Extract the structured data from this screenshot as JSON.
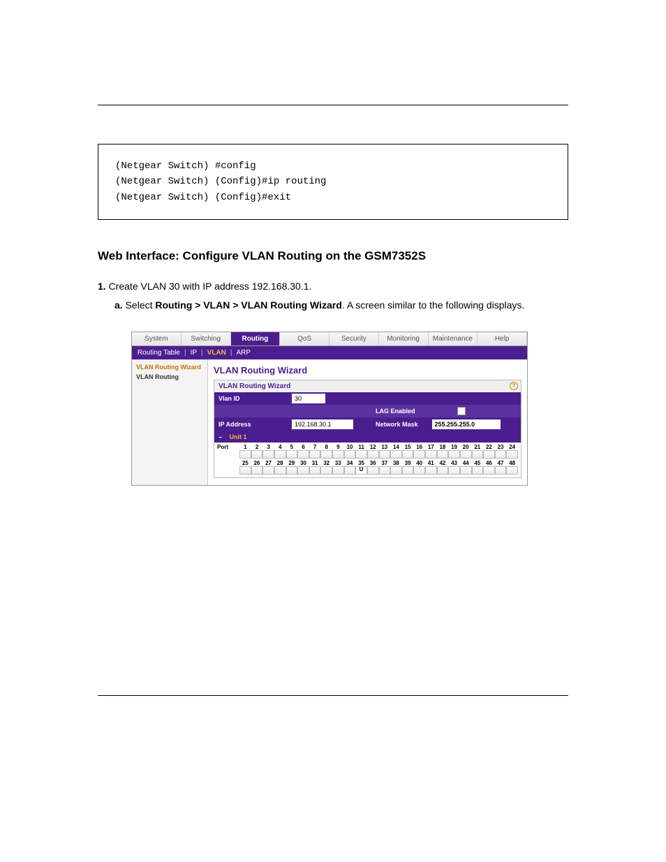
{
  "codebox": {
    "line1": "(Netgear Switch) #config",
    "line2": "(Netgear Switch) (Config)#ip routing",
    "line3": "(Netgear Switch) (Config)#exit"
  },
  "narrative": {
    "heading": "Web Interface: Configure VLAN Routing on the GSM7352S",
    "step_num": "1.",
    "step_text": "Create VLAN 30 with IP address 192.168.30.1.",
    "sub_a_label": "a.",
    "sub_a_text": "Select Routing > VLAN > VLAN Routing Wizard.",
    "sub_a_text_prefix": "Select ",
    "sub_a_text_bold": "Routing > VLAN > VLAN Routing Wizard",
    "sub_a_text_suffix": ". A screen similar to the following displays."
  },
  "screenshot": {
    "tabs": [
      "System",
      "Switching",
      "Routing",
      "QoS",
      "Security",
      "Monitoring",
      "Maintenance",
      "Help"
    ],
    "active_tab_index": 2,
    "subtabs": [
      "Routing Table",
      "IP",
      "VLAN",
      "ARP"
    ],
    "active_subtab_index": 2,
    "sidebar": {
      "selected": "VLAN Routing Wizard",
      "items": [
        "VLAN Routing"
      ]
    },
    "page_title": "VLAN Routing Wizard",
    "panel_title": "VLAN Routing Wizard",
    "fields": {
      "vlan_id_label": "Vlan ID",
      "vlan_id_value": "30",
      "lag_label": "LAG Enabled",
      "ip_label": "IP Address",
      "ip_value": "192.168.30.1",
      "mask_label": "Network Mask",
      "mask_value": "255.255.255.0",
      "unit_label": "Unit 1",
      "port_label": "Port"
    },
    "ports_row1": [
      "1",
      "2",
      "3",
      "4",
      "5",
      "6",
      "7",
      "8",
      "9",
      "10",
      "11",
      "12",
      "13",
      "14",
      "15",
      "16",
      "17",
      "18",
      "19",
      "20",
      "21",
      "22",
      "23",
      "24"
    ],
    "ports_row2": [
      "25",
      "26",
      "27",
      "28",
      "29",
      "30",
      "31",
      "32",
      "33",
      "34",
      "35",
      "36",
      "37",
      "38",
      "39",
      "40",
      "41",
      "42",
      "43",
      "44",
      "45",
      "46",
      "47",
      "48"
    ],
    "u_port_row2_index": 10
  }
}
